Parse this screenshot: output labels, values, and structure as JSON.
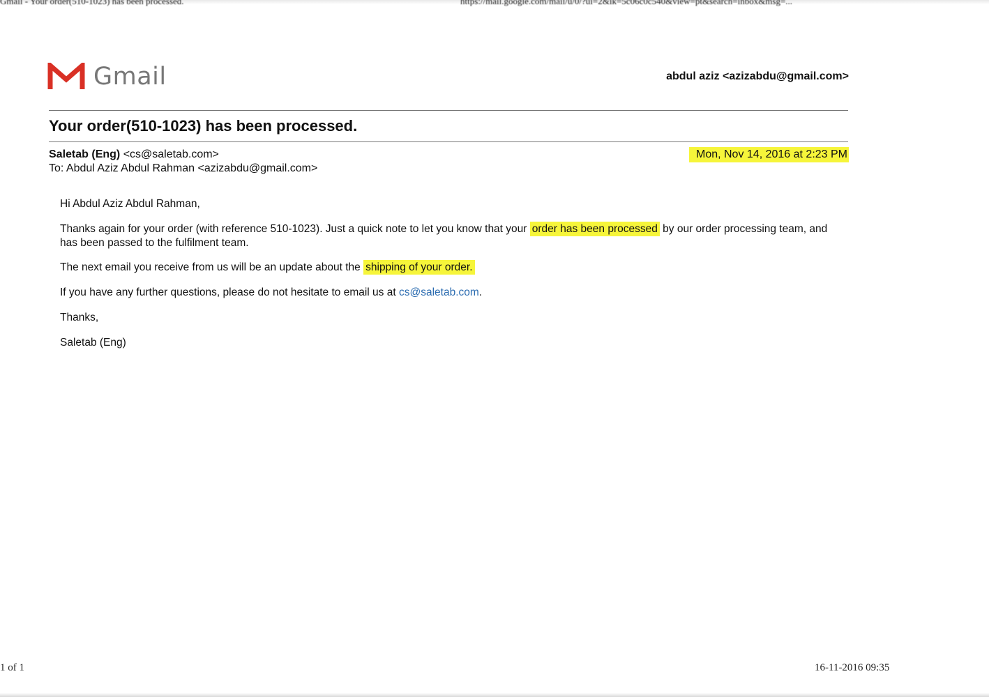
{
  "print_header": {
    "left": "Gmail - Your order(510-1023) has been processed.",
    "right": "https://mail.google.com/mail/u/0/?ui=2&ik=5c06c0c540&view=pt&search=inbox&msg=..."
  },
  "logo": {
    "text": "Gmail",
    "icon": "gmail-m-icon"
  },
  "account": "abdul aziz <azizabdu@gmail.com>",
  "email": {
    "subject": "Your order(510-1023) has been processed.",
    "sender_name": "Saletab (Eng)",
    "sender_email": "<cs@saletab.com>",
    "recipient": "To: Abdul Aziz Abdul Rahman <azizabdu@gmail.com>",
    "date": "Mon, Nov 14, 2016 at 2:23 PM",
    "greeting": "Hi Abdul Aziz Abdul Rahman,",
    "p1_a": "Thanks again for your order (with reference 510-1023). Just a quick note to let you know that your",
    "p1_hl": "order has been processed",
    "p1_b": "by our order processing team, and has been passed to the fulfilment team.",
    "p2_a": "The next email you receive from us will be an update about the",
    "p2_hl": "shipping of your order.",
    "p3_a": "If you have any further questions, please do not hesitate to email us at",
    "p3_link": "cs@saletab.com",
    "p3_b": ".",
    "thanks": "Thanks,",
    "signature": "Saletab (Eng)"
  },
  "footer": {
    "page": "1 of 1",
    "printed": "16-11-2016 09:35"
  },
  "colors": {
    "highlight": "#f6f53a",
    "gmail_red": "#d93025",
    "link": "#2a6bb0"
  }
}
